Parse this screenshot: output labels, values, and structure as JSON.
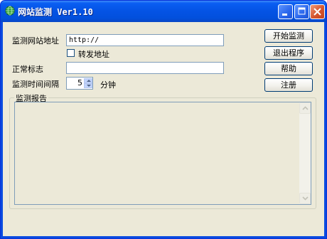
{
  "window": {
    "title": "网站监测 Ver1.10",
    "icon": "globe-icon",
    "controls": [
      "minimize-icon",
      "maximize-icon",
      "close-icon"
    ]
  },
  "form": {
    "url_label": "监测网站地址",
    "url_value": "http://",
    "redirect_checkbox_label": "转发地址",
    "redirect_checked": false,
    "normal_mark_label": "正常标志",
    "normal_mark_value": "",
    "interval_label": "监测时间间隔",
    "interval_value": "5",
    "interval_unit": "分钟"
  },
  "buttons": {
    "start": "开始监测",
    "exit": "退出程序",
    "help": "帮助",
    "register": "注册"
  },
  "report": {
    "label": "监测报告",
    "content": ""
  },
  "colors": {
    "titlebar": "#0453e4",
    "face": "#ece9d8",
    "field_border": "#7f9db9"
  }
}
